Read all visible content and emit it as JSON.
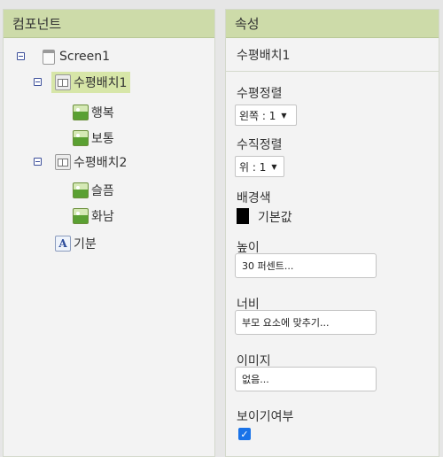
{
  "components_panel": {
    "title": "컴포넌트",
    "tree": [
      {
        "label": "Screen1",
        "icon": "screen-icon"
      },
      {
        "label": "수평배치1",
        "icon": "horizontal-arrangement-icon",
        "selected": true
      },
      {
        "label": "행복",
        "icon": "image-icon"
      },
      {
        "label": "보통",
        "icon": "image-icon"
      },
      {
        "label": "수평배치2",
        "icon": "horizontal-arrangement-icon"
      },
      {
        "label": "슬픔",
        "icon": "image-icon"
      },
      {
        "label": "화남",
        "icon": "image-icon"
      },
      {
        "label": "기분",
        "icon": "label-icon",
        "icon_glyph": "A"
      }
    ]
  },
  "properties_panel": {
    "title": "속성",
    "component_name": "수평배치1",
    "align_horizontal": {
      "label": "수평정렬",
      "value": "왼쪽 : 1"
    },
    "align_vertical": {
      "label": "수직정렬",
      "value": "위 : 1"
    },
    "background_color": {
      "label": "배경색",
      "value": "기본값",
      "swatch": "#000000"
    },
    "height": {
      "label": "높이",
      "value": "30 퍼센트..."
    },
    "width": {
      "label": "너비",
      "value": "부모 요소에 맞추기..."
    },
    "image": {
      "label": "이미지",
      "value": "없음..."
    },
    "visible": {
      "label": "보이기여부",
      "checked": true
    }
  },
  "colors": {
    "header": "#cddba9",
    "selected": "#d7e6a8",
    "checkbox": "#1a73e8"
  }
}
